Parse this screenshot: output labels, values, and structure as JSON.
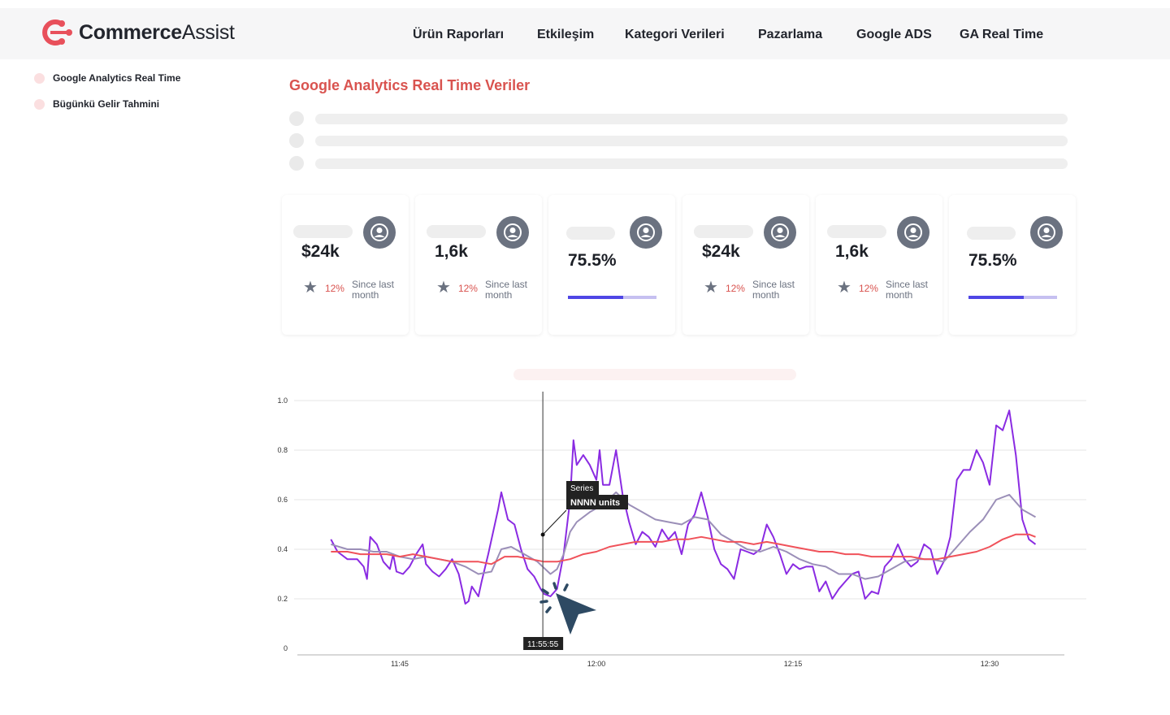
{
  "app": {
    "logo_bold": "Commerce",
    "logo_thin": "Assist",
    "brand_color": "#e8505b"
  },
  "nav": [
    {
      "label": "Ürün Raporları"
    },
    {
      "label": "Etkileşim"
    },
    {
      "label": "Kategori Verileri"
    },
    {
      "label": "Pazarlama"
    },
    {
      "label": "Google ADS"
    },
    {
      "label": "GA Real Time"
    }
  ],
  "sidebar": {
    "items": [
      {
        "label": "Google Analytics Real Time"
      },
      {
        "label": "Bügünkü Gelir Tahmini"
      }
    ]
  },
  "main": {
    "title": "Google Analytics Real Time Veriler"
  },
  "cards": [
    {
      "value": "$24k",
      "delta": "12%",
      "since": "Since last month",
      "icon": "user-circle-icon"
    },
    {
      "value": "1,6k",
      "delta": "12%",
      "since": "Since last month",
      "icon": "user-circle-icon"
    },
    {
      "value": "75.5%",
      "progress": 0.62,
      "icon": "user-circle-icon"
    },
    {
      "value": "$24k",
      "delta": "12%",
      "since": "Since last month",
      "icon": "user-circle-icon"
    },
    {
      "value": "1,6k",
      "delta": "12%",
      "since": "Since last month",
      "icon": "user-circle-icon"
    },
    {
      "value": "75.5%",
      "progress": 0.62,
      "icon": "user-circle-icon"
    }
  ],
  "tooltip": {
    "series": "Series",
    "value": "NNNN units",
    "x_label": "11:55:55"
  },
  "chart_data": {
    "type": "line",
    "xlabel": "",
    "ylabel": "",
    "x_range": [
      "11:39:45",
      "12:34:30"
    ],
    "ylim": [
      0,
      1.0
    ],
    "y_ticks": [
      "0",
      "0.2",
      "0.4",
      "0.6",
      "0.8",
      "1.0"
    ],
    "x_ticks": [
      "11:45",
      "12:00",
      "12:15",
      "12:30"
    ],
    "grid": true,
    "colors": {
      "raw": "#8a2be2",
      "smooth": "#9b8fb8",
      "trend": "#f0525a"
    },
    "series": [
      {
        "color": "#8a2be2",
        "points": [
          [
            "11:39:45",
            0.44
          ],
          [
            "11:40:15",
            0.39
          ],
          [
            "11:41:00",
            0.36
          ],
          [
            "11:41:45",
            0.36
          ],
          [
            "11:42:15",
            0.33
          ],
          [
            "11:42:30",
            0.28
          ],
          [
            "11:42:45",
            0.45
          ],
          [
            "11:43:15",
            0.42
          ],
          [
            "11:43:45",
            0.35
          ],
          [
            "11:44:15",
            0.32
          ],
          [
            "11:44:30",
            0.38
          ],
          [
            "11:44:45",
            0.31
          ],
          [
            "11:45:15",
            0.3
          ],
          [
            "11:45:45",
            0.33
          ],
          [
            "11:46:15",
            0.38
          ],
          [
            "11:46:30",
            0.4
          ],
          [
            "11:46:45",
            0.42
          ],
          [
            "11:47:00",
            0.34
          ],
          [
            "11:47:30",
            0.31
          ],
          [
            "11:48:00",
            0.29
          ],
          [
            "11:48:30",
            0.32
          ],
          [
            "11:49:00",
            0.36
          ],
          [
            "11:49:30",
            0.3
          ],
          [
            "11:50:00",
            0.18
          ],
          [
            "11:50:15",
            0.19
          ],
          [
            "11:50:30",
            0.25
          ],
          [
            "11:51:00",
            0.21
          ],
          [
            "11:51:15",
            0.27
          ],
          [
            "11:51:45",
            0.38
          ],
          [
            "11:52:30",
            0.56
          ],
          [
            "11:52:45",
            0.63
          ],
          [
            "11:53:15",
            0.52
          ],
          [
            "11:53:45",
            0.5
          ],
          [
            "11:54:15",
            0.4
          ],
          [
            "11:54:45",
            0.32
          ],
          [
            "11:55:15",
            0.29
          ],
          [
            "11:55:45",
            0.24
          ],
          [
            "11:56:00",
            0.22
          ],
          [
            "11:56:30",
            0.21
          ],
          [
            "11:57:00",
            0.24
          ],
          [
            "11:57:30",
            0.38
          ],
          [
            "11:58:00",
            0.6
          ],
          [
            "11:58:15",
            0.84
          ],
          [
            "11:58:30",
            0.74
          ],
          [
            "11:59:00",
            0.78
          ],
          [
            "11:59:30",
            0.74
          ],
          [
            "12:00:00",
            0.68
          ],
          [
            "12:00:15",
            0.8
          ],
          [
            "12:00:30",
            0.66
          ],
          [
            "12:01:00",
            0.66
          ],
          [
            "12:01:30",
            0.8
          ],
          [
            "12:02:00",
            0.62
          ],
          [
            "12:02:30",
            0.51
          ],
          [
            "12:03:00",
            0.42
          ],
          [
            "12:03:30",
            0.47
          ],
          [
            "12:04:00",
            0.45
          ],
          [
            "12:04:30",
            0.41
          ],
          [
            "12:05:00",
            0.48
          ],
          [
            "12:05:30",
            0.44
          ],
          [
            "12:06:00",
            0.47
          ],
          [
            "12:06:30",
            0.38
          ],
          [
            "12:07:00",
            0.5
          ],
          [
            "12:07:30",
            0.54
          ],
          [
            "12:08:00",
            0.63
          ],
          [
            "12:08:30",
            0.53
          ],
          [
            "12:09:00",
            0.4
          ],
          [
            "12:09:30",
            0.34
          ],
          [
            "12:10:00",
            0.32
          ],
          [
            "12:10:30",
            0.28
          ],
          [
            "12:11:00",
            0.4
          ],
          [
            "12:11:30",
            0.39
          ],
          [
            "12:12:00",
            0.38
          ],
          [
            "12:12:30",
            0.4
          ],
          [
            "12:13:00",
            0.5
          ],
          [
            "12:13:30",
            0.45
          ],
          [
            "12:14:00",
            0.38
          ],
          [
            "12:14:30",
            0.3
          ],
          [
            "12:15:00",
            0.34
          ],
          [
            "12:15:30",
            0.32
          ],
          [
            "12:16:00",
            0.33
          ],
          [
            "12:16:30",
            0.33
          ],
          [
            "12:17:00",
            0.23
          ],
          [
            "12:17:30",
            0.27
          ],
          [
            "12:18:00",
            0.2
          ],
          [
            "12:18:30",
            0.24
          ],
          [
            "12:19:00",
            0.27
          ],
          [
            "12:19:30",
            0.3
          ],
          [
            "12:20:00",
            0.31
          ],
          [
            "12:20:30",
            0.2
          ],
          [
            "12:21:00",
            0.23
          ],
          [
            "12:21:30",
            0.22
          ],
          [
            "12:22:00",
            0.33
          ],
          [
            "12:22:30",
            0.36
          ],
          [
            "12:23:00",
            0.42
          ],
          [
            "12:23:30",
            0.36
          ],
          [
            "12:24:00",
            0.33
          ],
          [
            "12:24:30",
            0.35
          ],
          [
            "12:25:00",
            0.42
          ],
          [
            "12:25:30",
            0.4
          ],
          [
            "12:26:00",
            0.3
          ],
          [
            "12:26:30",
            0.35
          ],
          [
            "12:27:00",
            0.45
          ],
          [
            "12:27:30",
            0.68
          ],
          [
            "12:28:00",
            0.72
          ],
          [
            "12:28:30",
            0.72
          ],
          [
            "12:29:00",
            0.8
          ],
          [
            "12:29:30",
            0.75
          ],
          [
            "12:30:00",
            0.66
          ],
          [
            "12:30:30",
            0.9
          ],
          [
            "12:31:00",
            0.88
          ],
          [
            "12:31:30",
            0.96
          ],
          [
            "12:32:00",
            0.78
          ],
          [
            "12:32:30",
            0.52
          ],
          [
            "12:33:00",
            0.44
          ],
          [
            "12:33:30",
            0.42
          ]
        ]
      },
      {
        "color": "#9b8fb8",
        "points": [
          [
            "11:39:45",
            0.42
          ],
          [
            "11:41:00",
            0.4
          ],
          [
            "11:42:00",
            0.4
          ],
          [
            "11:43:00",
            0.39
          ],
          [
            "11:44:00",
            0.39
          ],
          [
            "11:45:00",
            0.37
          ],
          [
            "11:46:00",
            0.36
          ],
          [
            "11:47:00",
            0.37
          ],
          [
            "11:48:00",
            0.36
          ],
          [
            "11:49:00",
            0.35
          ],
          [
            "11:50:00",
            0.33
          ],
          [
            "11:51:00",
            0.3
          ],
          [
            "11:52:00",
            0.31
          ],
          [
            "11:52:45",
            0.4
          ],
          [
            "11:53:30",
            0.41
          ],
          [
            "11:54:30",
            0.38
          ],
          [
            "11:55:30",
            0.35
          ],
          [
            "11:56:30",
            0.3
          ],
          [
            "11:57:00",
            0.32
          ],
          [
            "11:57:30",
            0.38
          ],
          [
            "11:58:00",
            0.47
          ],
          [
            "11:58:30",
            0.51
          ],
          [
            "11:59:30",
            0.55
          ],
          [
            "12:00:30",
            0.58
          ],
          [
            "12:01:30",
            0.63
          ],
          [
            "12:02:30",
            0.58
          ],
          [
            "12:03:30",
            0.55
          ],
          [
            "12:04:30",
            0.52
          ],
          [
            "12:05:30",
            0.51
          ],
          [
            "12:06:30",
            0.5
          ],
          [
            "12:07:30",
            0.53
          ],
          [
            "12:08:30",
            0.52
          ],
          [
            "12:09:30",
            0.46
          ],
          [
            "12:10:30",
            0.43
          ],
          [
            "12:11:30",
            0.4
          ],
          [
            "12:12:30",
            0.39
          ],
          [
            "12:13:30",
            0.41
          ],
          [
            "12:14:30",
            0.39
          ],
          [
            "12:15:30",
            0.36
          ],
          [
            "12:16:30",
            0.34
          ],
          [
            "12:17:30",
            0.33
          ],
          [
            "12:18:30",
            0.3
          ],
          [
            "12:19:30",
            0.3
          ],
          [
            "12:20:30",
            0.28
          ],
          [
            "12:21:30",
            0.29
          ],
          [
            "12:22:30",
            0.32
          ],
          [
            "12:23:30",
            0.35
          ],
          [
            "12:24:30",
            0.36
          ],
          [
            "12:25:30",
            0.36
          ],
          [
            "12:26:30",
            0.35
          ],
          [
            "12:27:30",
            0.41
          ],
          [
            "12:28:30",
            0.47
          ],
          [
            "12:29:30",
            0.52
          ],
          [
            "12:30:30",
            0.6
          ],
          [
            "12:31:30",
            0.62
          ],
          [
            "12:32:30",
            0.56
          ],
          [
            "12:33:30",
            0.53
          ]
        ]
      },
      {
        "color": "#f0525a",
        "points": [
          [
            "11:39:45",
            0.39
          ],
          [
            "11:41:00",
            0.39
          ],
          [
            "11:42:00",
            0.38
          ],
          [
            "11:43:00",
            0.38
          ],
          [
            "11:44:00",
            0.38
          ],
          [
            "11:45:00",
            0.37
          ],
          [
            "11:46:00",
            0.38
          ],
          [
            "11:47:00",
            0.37
          ],
          [
            "11:48:00",
            0.36
          ],
          [
            "11:49:00",
            0.35
          ],
          [
            "11:50:00",
            0.35
          ],
          [
            "11:51:00",
            0.35
          ],
          [
            "11:52:00",
            0.34
          ],
          [
            "11:53:00",
            0.37
          ],
          [
            "11:54:00",
            0.37
          ],
          [
            "11:55:00",
            0.36
          ],
          [
            "11:56:00",
            0.35
          ],
          [
            "11:57:00",
            0.35
          ],
          [
            "11:58:00",
            0.36
          ],
          [
            "11:59:00",
            0.38
          ],
          [
            "12:00:00",
            0.39
          ],
          [
            "12:01:00",
            0.41
          ],
          [
            "12:02:00",
            0.42
          ],
          [
            "12:03:00",
            0.43
          ],
          [
            "12:04:00",
            0.43
          ],
          [
            "12:05:00",
            0.43
          ],
          [
            "12:06:00",
            0.44
          ],
          [
            "12:07:00",
            0.44
          ],
          [
            "12:08:00",
            0.45
          ],
          [
            "12:09:00",
            0.44
          ],
          [
            "12:10:00",
            0.43
          ],
          [
            "12:11:00",
            0.43
          ],
          [
            "12:12:00",
            0.42
          ],
          [
            "12:13:00",
            0.43
          ],
          [
            "12:14:00",
            0.42
          ],
          [
            "12:15:00",
            0.41
          ],
          [
            "12:16:00",
            0.4
          ],
          [
            "12:17:00",
            0.39
          ],
          [
            "12:18:00",
            0.39
          ],
          [
            "12:19:00",
            0.38
          ],
          [
            "12:20:00",
            0.38
          ],
          [
            "12:21:00",
            0.37
          ],
          [
            "12:22:00",
            0.37
          ],
          [
            "12:23:00",
            0.37
          ],
          [
            "12:24:00",
            0.37
          ],
          [
            "12:25:00",
            0.36
          ],
          [
            "12:26:00",
            0.36
          ],
          [
            "12:27:00",
            0.37
          ],
          [
            "12:28:00",
            0.38
          ],
          [
            "12:29:00",
            0.39
          ],
          [
            "12:30:00",
            0.41
          ],
          [
            "12:31:00",
            0.44
          ],
          [
            "12:32:00",
            0.46
          ],
          [
            "12:33:00",
            0.46
          ],
          [
            "12:33:30",
            0.45
          ]
        ]
      }
    ]
  }
}
